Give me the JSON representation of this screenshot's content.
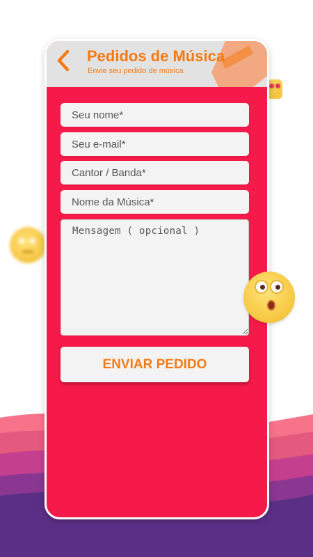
{
  "header": {
    "title": "Pedidos de Música",
    "subtitle": "Envie seu pedido de música"
  },
  "form": {
    "name_placeholder": "Seu nome*",
    "email_placeholder": "Seu e-mail*",
    "artist_placeholder": "Cantor / Banda*",
    "song_placeholder": "Nome da Música*",
    "message_placeholder": "Mensagem ( opcional )",
    "submit_label": "ENVIAR PEDIDO"
  },
  "colors": {
    "card_background": "#f61a4a",
    "accent": "#f47b14",
    "header_background": "#e2e2e2",
    "field_background": "#f3f3f3"
  },
  "icons": {
    "back": "chevron-left-icon",
    "emoji_left": "smiley-emoji-icon",
    "emoji_right": "surprised-emoji-icon",
    "emoji_top": "heart-eyes-emoji-icon"
  }
}
